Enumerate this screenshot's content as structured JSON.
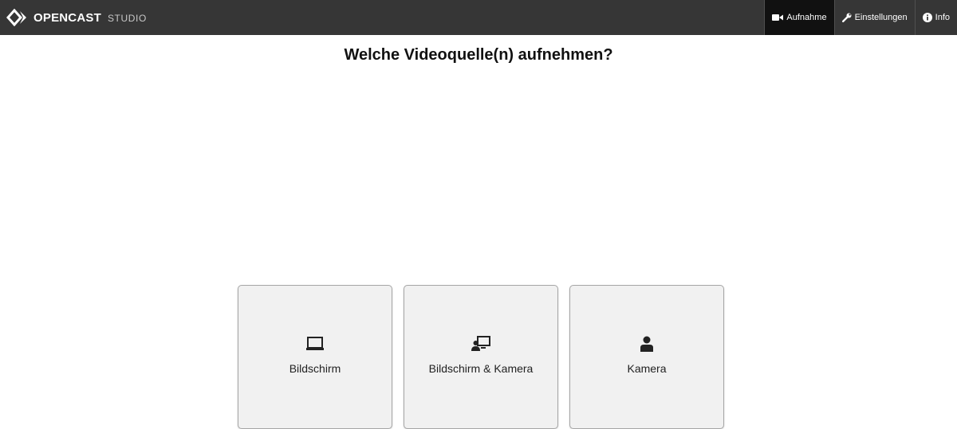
{
  "header": {
    "brand_name": "OPENCAST",
    "brand_sub": "STUDIO",
    "logo_icon": "opencast-logo-icon",
    "nav": [
      {
        "label": "Aufnahme",
        "icon": "video-camera-icon",
        "active": true
      },
      {
        "label": "Einstellungen",
        "icon": "wrench-icon",
        "active": false
      },
      {
        "label": "Info",
        "icon": "info-circle-icon",
        "active": false
      }
    ]
  },
  "main": {
    "title": "Welche Videoquelle(n) aufnehmen?",
    "options": [
      {
        "label": "Bildschirm",
        "icon": "monitor-icon"
      },
      {
        "label": "Bildschirm & Kamera",
        "icon": "presenter-screen-icon"
      },
      {
        "label": "Kamera",
        "icon": "user-icon"
      }
    ]
  },
  "colors": {
    "topbar": "#363636",
    "active_nav": "#111111",
    "card_bg": "#f1f1f1",
    "card_border": "#a6a6a6"
  }
}
